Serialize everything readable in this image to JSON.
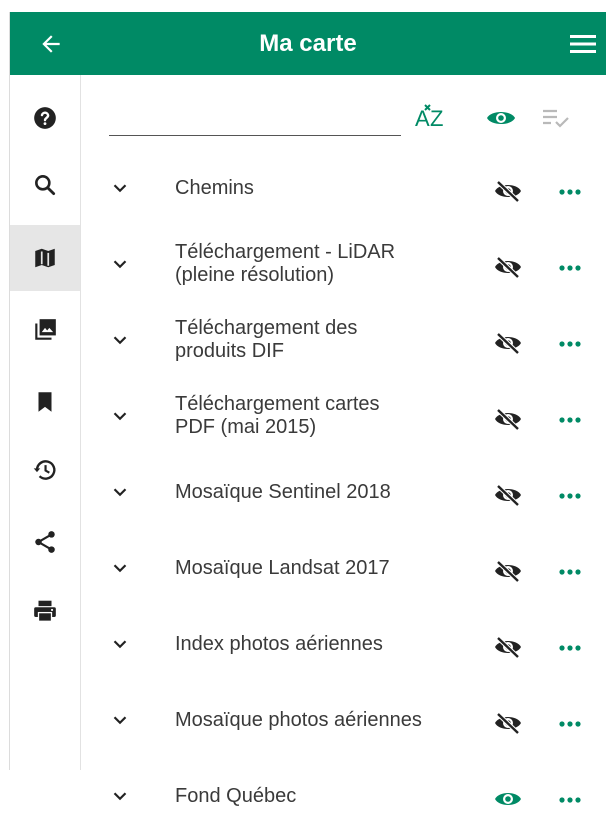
{
  "header": {
    "title": "Ma carte"
  },
  "colors": {
    "primary": "#008a65",
    "icon_dark": "#222222",
    "eye_visible": "#008a65"
  },
  "sidebar": {
    "items": [
      {
        "icon": "help-icon"
      },
      {
        "icon": "search-icon"
      },
      {
        "icon": "map-icon",
        "active": true
      },
      {
        "icon": "photo-library-icon"
      },
      {
        "icon": "bookmark-icon"
      },
      {
        "icon": "history-icon"
      },
      {
        "icon": "share-icon"
      },
      {
        "icon": "print-icon"
      }
    ]
  },
  "toolbar": {
    "filter_placeholder": "",
    "sort_icon": "sort-az-icon",
    "visibility_icon": "eye-icon",
    "select_icon": "checklist-icon"
  },
  "layers": [
    {
      "lines": [
        "Chemins"
      ],
      "visible": false
    },
    {
      "lines": [
        "Téléchargement - LiDAR",
        "(pleine résolution)"
      ],
      "visible": false
    },
    {
      "lines": [
        "Téléchargement des",
        "produits DIF"
      ],
      "visible": false
    },
    {
      "lines": [
        "Téléchargement cartes",
        "PDF (mai 2015)"
      ],
      "visible": false
    },
    {
      "lines": [
        "Mosaïque Sentinel 2018"
      ],
      "visible": false
    },
    {
      "lines": [
        "Mosaïque Landsat 2017"
      ],
      "visible": false
    },
    {
      "lines": [
        "Index photos aériennes"
      ],
      "visible": false
    },
    {
      "lines": [
        "Mosaïque photos aériennes"
      ],
      "visible": false
    },
    {
      "lines": [
        "Fond Québec"
      ],
      "visible": true
    }
  ]
}
